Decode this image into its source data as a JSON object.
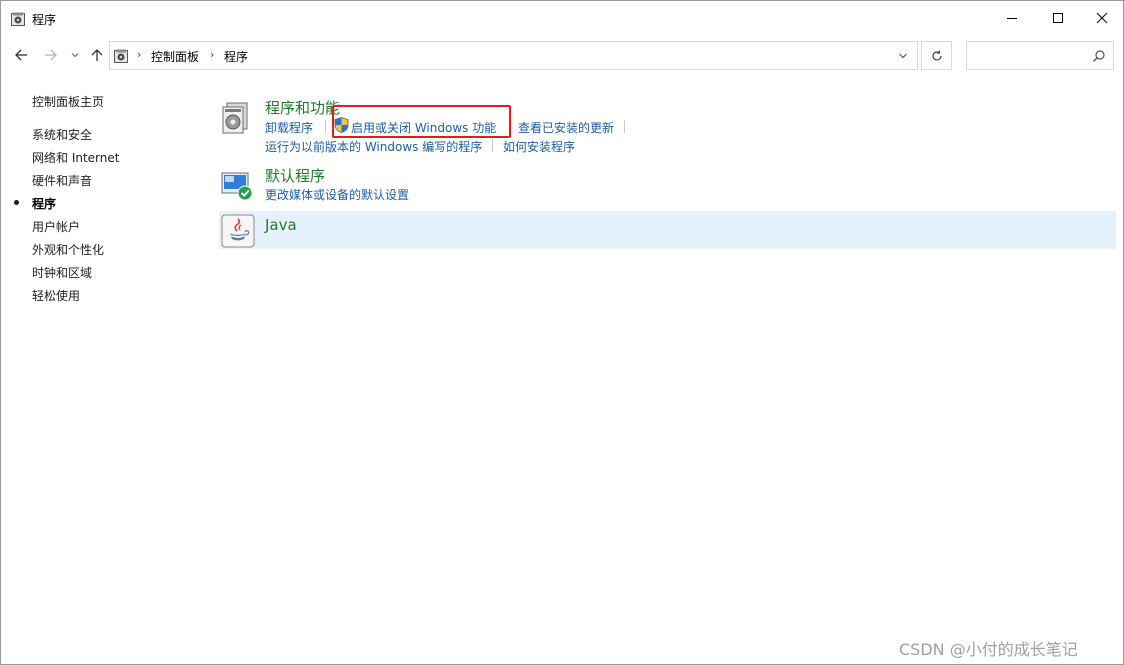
{
  "window": {
    "title": "程序"
  },
  "address": {
    "crumbs": [
      "控制面板",
      "程序"
    ],
    "search_placeholder": ""
  },
  "sidebar": {
    "home": "控制面板主页",
    "items": [
      {
        "label": "系统和安全",
        "active": false
      },
      {
        "label": "网络和 Internet",
        "active": false
      },
      {
        "label": "硬件和声音",
        "active": false
      },
      {
        "label": "程序",
        "active": true
      },
      {
        "label": "用户帐户",
        "active": false
      },
      {
        "label": "外观和个性化",
        "active": false
      },
      {
        "label": "时钟和区域",
        "active": false
      },
      {
        "label": "轻松使用",
        "active": false
      }
    ]
  },
  "categories": [
    {
      "title": "程序和功能",
      "links": [
        "卸载程序",
        "启用或关闭 Windows 功能",
        "查看已安装的更新",
        "运行为以前版本的 Windows 编写的程序",
        "如何安装程序"
      ]
    },
    {
      "title": "默认程序",
      "links": [
        "更改媒体或设备的默认设置"
      ]
    },
    {
      "title": "Java",
      "links": []
    }
  ],
  "watermark": "CSDN @小付的成长笔记",
  "colors": {
    "link": "#1b5fa8",
    "category_title": "#1e7b2b",
    "highlight": "#e21b1b",
    "selected_row": "#e5f1fb"
  }
}
